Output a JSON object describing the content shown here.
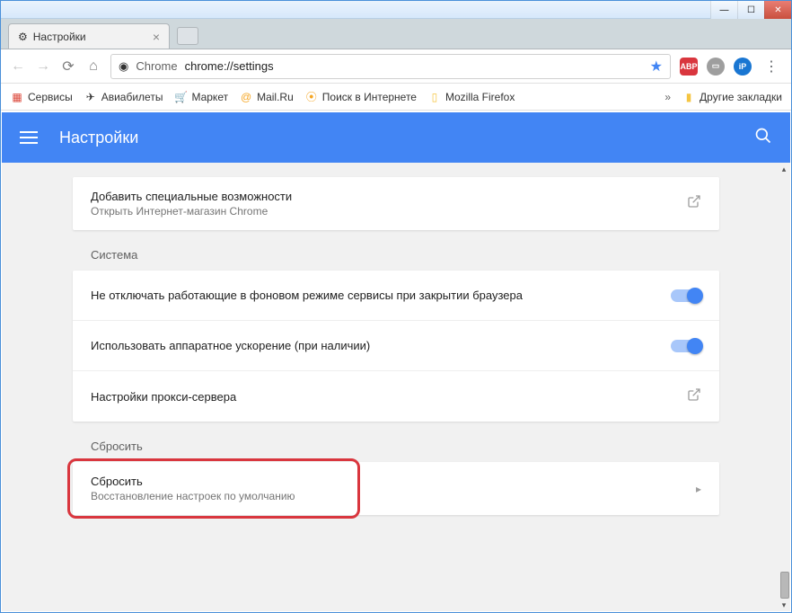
{
  "window": {
    "tab_title": "Настройки"
  },
  "toolbar": {
    "chrome_label": "Chrome",
    "url_path": "chrome://settings"
  },
  "bookmarks": {
    "apps": "Сервисы",
    "items": [
      "Авиабилеты",
      "Маркет",
      "Mail.Ru",
      "Поиск в Интернете",
      "Mozilla Firefox"
    ],
    "overflow": "»",
    "other": "Другие закладки"
  },
  "header": {
    "title": "Настройки"
  },
  "rows": {
    "accessibility": {
      "title": "Добавить специальные возможности",
      "sub": "Открыть Интернет-магазин Chrome"
    },
    "system_label": "Система",
    "bg_services": "Не отключать работающие в фоновом режиме сервисы при закрытии браузера",
    "hw_accel": "Использовать аппаратное ускорение (при наличии)",
    "proxy": "Настройки прокси-сервера",
    "reset_label": "Сбросить",
    "reset": {
      "title": "Сбросить",
      "sub": "Восстановление настроек по умолчанию"
    }
  },
  "extensions": {
    "abp": "ABP"
  }
}
